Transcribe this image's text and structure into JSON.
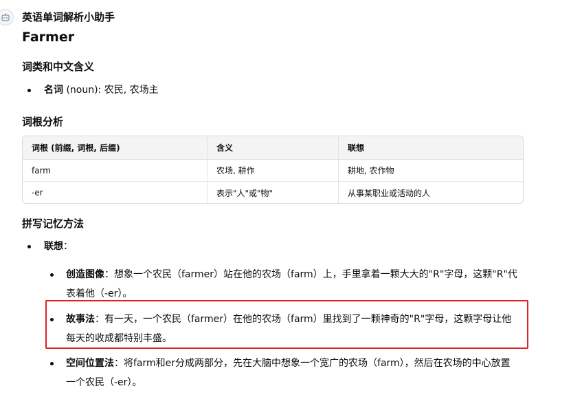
{
  "assistant": {
    "avatar_icon": "robot-face-icon",
    "name": "英语单词解析小助手"
  },
  "word": "Farmer",
  "sections": {
    "pos_heading": "词类和中文含义",
    "pos_item": {
      "label": "名词",
      "text": " (noun): 农民, 农场主"
    },
    "root_heading": "词根分析",
    "memory_heading": "拼写记忆方法"
  },
  "table": {
    "headers": [
      "词根 (前缀, 词根, 后缀)",
      "含义",
      "联想"
    ],
    "rows": [
      [
        "farm",
        "农场, 耕作",
        "耕地, 农作物"
      ],
      [
        "-er",
        "表示\"人\"或\"物\"",
        "从事某职业或活动的人"
      ]
    ]
  },
  "memory": {
    "association_label": "联想",
    "association_colon": "：",
    "items": [
      {
        "label": "创造图像",
        "text": "：想象一个农民（farmer）站在他的农场（farm）上，手里拿着一颗大大的\"R\"字母，这颗\"R\"代表着他（-er）。"
      },
      {
        "label": "故事法",
        "text": "：有一天，一个农民（farmer）在他的农场（farm）里找到了一颗神奇的\"R\"字母，这颗字母让他每天的收成都特别丰盛。"
      },
      {
        "label": "空间位置法",
        "text": "：将farm和er分成两部分，先在大脑中想象一个宽广的农场（farm），然后在农场的中心放置一个农民（-er）。"
      }
    ]
  },
  "colors": {
    "highlight_border": "#e02020",
    "table_header_bg": "#f4f4f4",
    "text": "#0d0d0d"
  }
}
